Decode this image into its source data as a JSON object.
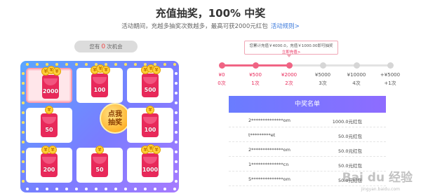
{
  "header": {
    "title": "充值抽奖，100% 中奖",
    "subtitle": "活动期间，充越多抽奖次数越多，最高可获2000元红包",
    "rules_link": "活动规则>"
  },
  "chances": {
    "prefix": "您有",
    "count": "0",
    "suffix": "次机会"
  },
  "board": {
    "cells": [
      {
        "value": "2000",
        "coin": "¥"
      },
      {
        "value": "100",
        "coin": "¥"
      },
      {
        "value": "500",
        "coin": "¥"
      },
      {
        "value": "50",
        "coin": "¥"
      },
      {
        "value": "100",
        "coin": "¥"
      },
      {
        "value": "200",
        "coin": "¥"
      },
      {
        "value": "50",
        "coin": "¥"
      },
      {
        "value": "1000",
        "coin": "¥"
      }
    ],
    "draw_label_line1": "点我",
    "draw_label_line2": "抽奖",
    "colors": {
      "envelope": "#e8295a",
      "board_start": "#5aa6ff",
      "board_end": "#a77bff",
      "accent": "#f06484"
    }
  },
  "progress": {
    "tip": "您累计充值￥4000.0，充值￥1000.00即可抽奖",
    "tip_link": "立即充值>",
    "filled_fraction": 0.4,
    "steps": [
      {
        "amount": "¥0",
        "times": "0次",
        "active": true
      },
      {
        "amount": "¥500",
        "times": "1次",
        "active": true
      },
      {
        "amount": "¥2000",
        "times": "2次",
        "active": true
      },
      {
        "amount": "¥5000",
        "times": "3次",
        "active": false
      },
      {
        "amount": "¥10000",
        "times": "4次",
        "active": false
      },
      {
        "amount": "+¥5000",
        "times": "+1次",
        "active": false
      }
    ]
  },
  "winners": {
    "title": "中奖名单",
    "rows": [
      {
        "name": "2**************om",
        "prize": "1000.0元红包"
      },
      {
        "name": "t*********et",
        "prize": "50.0元红包"
      },
      {
        "name": "2**************om",
        "prize": "50.0元红包"
      },
      {
        "name": "1**************cn",
        "prize": "50.0元红包"
      },
      {
        "name": "5**************om",
        "prize": "50.0元红包"
      }
    ]
  },
  "watermark": {
    "text": "Bai du 经验",
    "sub": "jingyan.baidu.com"
  }
}
